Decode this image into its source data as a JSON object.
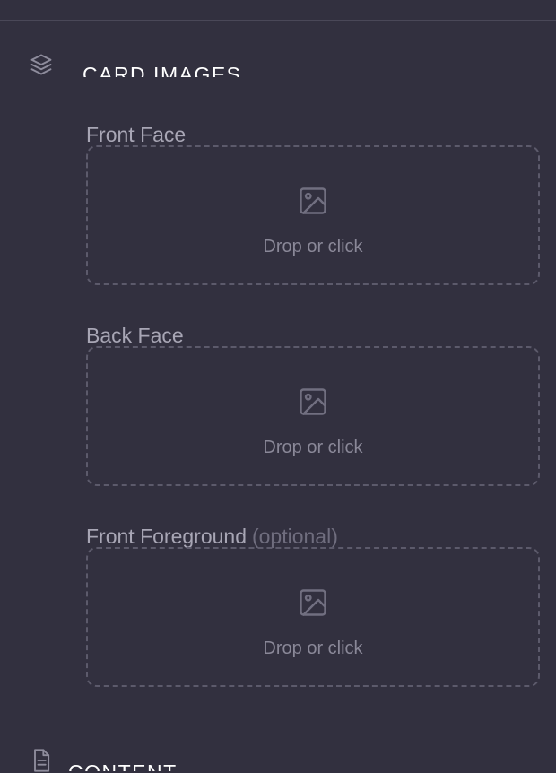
{
  "sections": {
    "card_images": {
      "title": "CARD IMAGES",
      "icon": "layers-icon"
    },
    "content": {
      "title": "CONTENT",
      "icon": "document-icon"
    }
  },
  "fields": [
    {
      "label": "Front Face",
      "optional_label": "",
      "drop_text": "Drop or click",
      "icon": "image-icon"
    },
    {
      "label": "Back Face",
      "optional_label": "",
      "drop_text": "Drop or click",
      "icon": "image-icon"
    },
    {
      "label": "Front Foreground",
      "optional_label": "(optional)",
      "drop_text": "Drop or click",
      "icon": "image-icon"
    }
  ],
  "colors": {
    "background": "#32303f",
    "heading": "#ffffff",
    "label": "#a8a6b5",
    "muted": "#6f6d7e",
    "dashed_border": "#5c5a6b"
  }
}
